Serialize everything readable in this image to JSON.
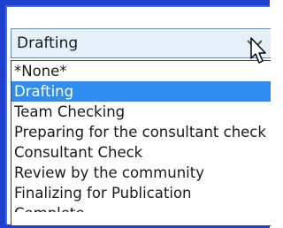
{
  "combo": {
    "value": "Drafting"
  },
  "dropdown": {
    "items": [
      {
        "label": "*None*",
        "selected": false
      },
      {
        "label": "Drafting",
        "selected": true
      },
      {
        "label": "Team Checking",
        "selected": false
      },
      {
        "label": "Preparing for the consultant check",
        "selected": false
      },
      {
        "label": "Consultant Check",
        "selected": false
      },
      {
        "label": "Review by the community",
        "selected": false
      },
      {
        "label": "Finalizing for Publication",
        "selected": false
      },
      {
        "label": "Complete",
        "selected": false
      }
    ]
  },
  "colors": {
    "frame": "#1f3fcf",
    "selection": "#2f8cf0",
    "combo_bg": "#e6f0fb"
  },
  "icons": {
    "combo_arrow": "chevron-down-icon",
    "cursor": "mouse-pointer-icon"
  }
}
